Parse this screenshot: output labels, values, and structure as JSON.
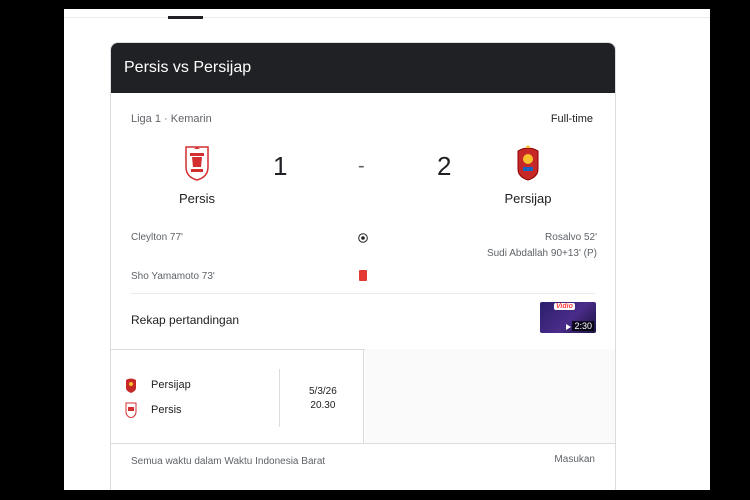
{
  "match": {
    "title": "Persis vs Persijap",
    "meta": "Liga 1 · Kemarin",
    "status": "Full-time",
    "home": {
      "name": "Persis",
      "score": "1",
      "color": "#d32f2f"
    },
    "away": {
      "name": "Persijap",
      "score": "2",
      "color": "#c62828"
    },
    "separator": "-"
  },
  "events": {
    "home": [
      {
        "text": "Cleylton 77'",
        "icon": "soccer-ball-icon"
      },
      {
        "text": "Sho Yamamoto 73'",
        "icon": "red-card-icon"
      }
    ],
    "away": [
      {
        "text": "Rosalvo 52'"
      },
      {
        "text": "Sudi Abdallah 90+13' (P)"
      }
    ]
  },
  "recap": {
    "label": "Rekap pertandingan",
    "thumbnail": {
      "brand": "Vidio",
      "duration": "2:30",
      "icon": "play-icon"
    }
  },
  "schedule": {
    "team1": "Persijap",
    "team2": "Persis",
    "date": "5/3/26",
    "time": "20.30"
  },
  "footer": {
    "note": "Semua waktu dalam Waktu Indonesia Barat",
    "feedback": "Masukan"
  },
  "colors": {
    "header_bg": "#202124",
    "red_card": "#e53935",
    "border": "#dadce0"
  }
}
